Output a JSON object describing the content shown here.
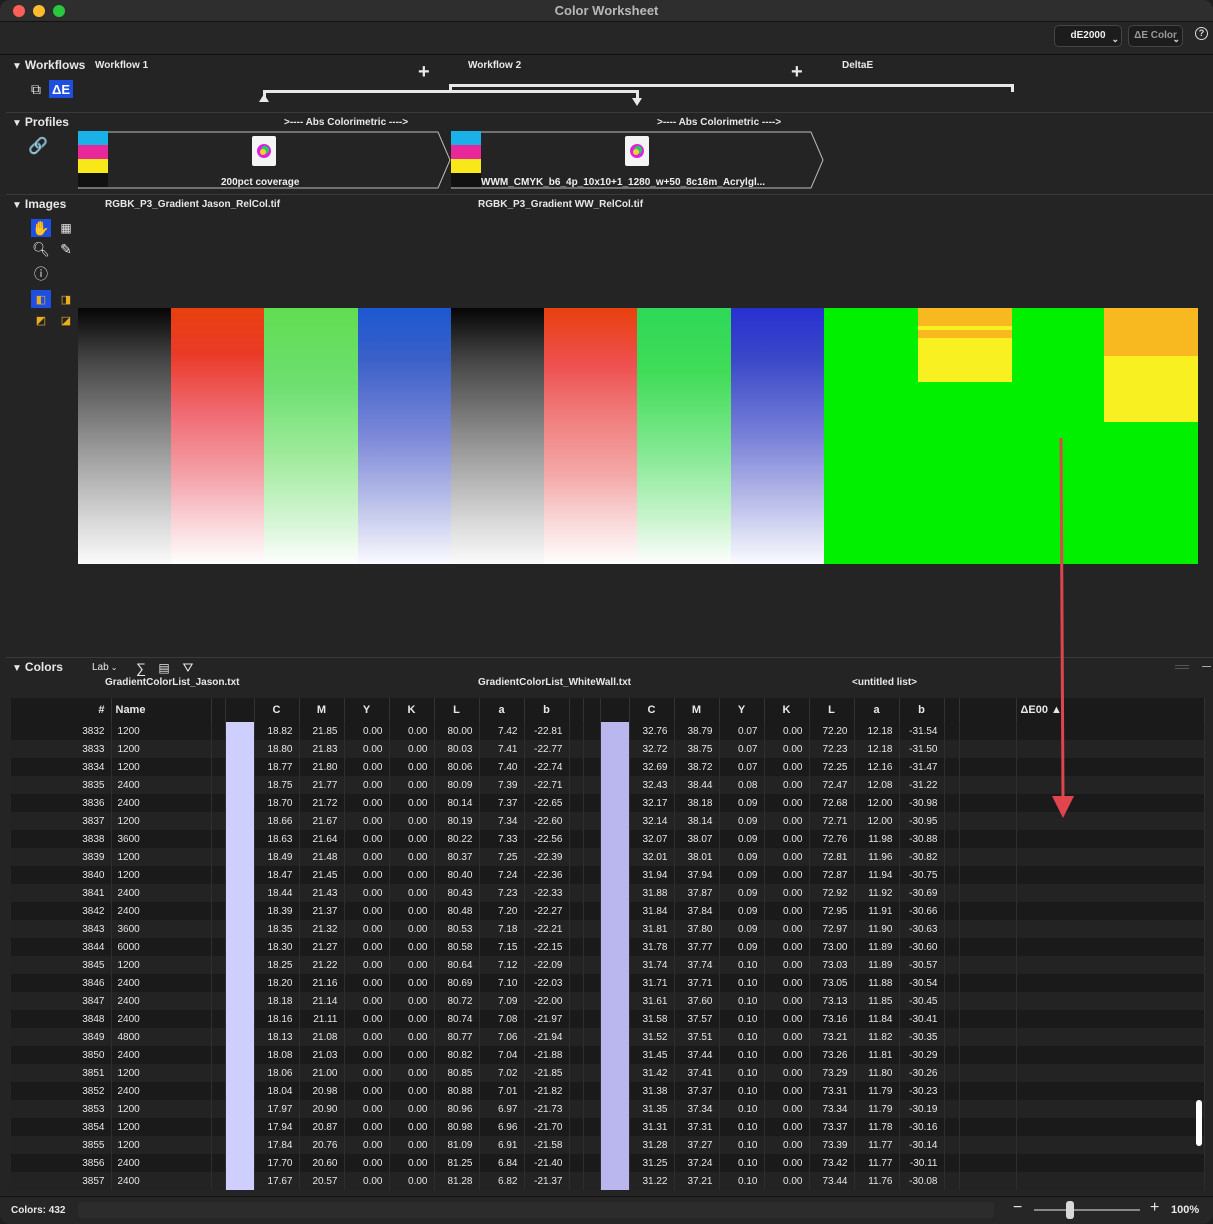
{
  "window": {
    "title": "Color Worksheet"
  },
  "toolbar": {
    "de_button": "dE2000",
    "de_color_button": "ΔE Color",
    "help": "?"
  },
  "workflows": {
    "header": "Workflows",
    "items": [
      "Workflow 1",
      "Workflow 2",
      "DeltaE"
    ],
    "add_symbol": "+"
  },
  "profiles": {
    "header": "Profiles",
    "intents": [
      ">---- Abs Colorimetric ---->",
      ">---- Abs Colorimetric ---->"
    ],
    "items": [
      "200pct coverage",
      "WWM_CMYK_b6_4p_10x10+1_1280_w+50_8c16m_Acrylgl..."
    ]
  },
  "images": {
    "header": "Images",
    "items": [
      "RGBK_P3_Gradient Jason_RelCol.tif",
      "RGBK_P3_Gradient WW_RelCol.tif"
    ]
  },
  "colors": {
    "header": "Colors",
    "mode": "Lab",
    "lists": [
      "GradientColorList_Jason.txt",
      "GradientColorList_WhiteWall.txt",
      "<untitled list>"
    ],
    "columns": [
      "#",
      "Name",
      "",
      "C",
      "M",
      "Y",
      "K",
      "L",
      "a",
      "b",
      "",
      "C",
      "M",
      "Y",
      "K",
      "L",
      "a",
      "b",
      "",
      "ΔE00 ▲"
    ],
    "rows": [
      [
        "3832",
        "1200",
        "18.82",
        "21.85",
        "0.00",
        "0.00",
        "80.00",
        "7.42",
        "-22.81",
        "32.76",
        "38.79",
        "0.07",
        "0.00",
        "72.20",
        "12.18",
        "-31.54"
      ],
      [
        "3833",
        "1200",
        "18.80",
        "21.83",
        "0.00",
        "0.00",
        "80.03",
        "7.41",
        "-22.77",
        "32.72",
        "38.75",
        "0.07",
        "0.00",
        "72.23",
        "12.18",
        "-31.50"
      ],
      [
        "3834",
        "1200",
        "18.77",
        "21.80",
        "0.00",
        "0.00",
        "80.06",
        "7.40",
        "-22.74",
        "32.69",
        "38.72",
        "0.07",
        "0.00",
        "72.25",
        "12.16",
        "-31.47"
      ],
      [
        "3835",
        "2400",
        "18.75",
        "21.77",
        "0.00",
        "0.00",
        "80.09",
        "7.39",
        "-22.71",
        "32.43",
        "38.44",
        "0.08",
        "0.00",
        "72.47",
        "12.08",
        "-31.22"
      ],
      [
        "3836",
        "2400",
        "18.70",
        "21.72",
        "0.00",
        "0.00",
        "80.14",
        "7.37",
        "-22.65",
        "32.17",
        "38.18",
        "0.09",
        "0.00",
        "72.68",
        "12.00",
        "-30.98"
      ],
      [
        "3837",
        "1200",
        "18.66",
        "21.67",
        "0.00",
        "0.00",
        "80.19",
        "7.34",
        "-22.60",
        "32.14",
        "38.14",
        "0.09",
        "0.00",
        "72.71",
        "12.00",
        "-30.95"
      ],
      [
        "3838",
        "3600",
        "18.63",
        "21.64",
        "0.00",
        "0.00",
        "80.22",
        "7.33",
        "-22.56",
        "32.07",
        "38.07",
        "0.09",
        "0.00",
        "72.76",
        "11.98",
        "-30.88"
      ],
      [
        "3839",
        "1200",
        "18.49",
        "21.48",
        "0.00",
        "0.00",
        "80.37",
        "7.25",
        "-22.39",
        "32.01",
        "38.01",
        "0.09",
        "0.00",
        "72.81",
        "11.96",
        "-30.82"
      ],
      [
        "3840",
        "1200",
        "18.47",
        "21.45",
        "0.00",
        "0.00",
        "80.40",
        "7.24",
        "-22.36",
        "31.94",
        "37.94",
        "0.09",
        "0.00",
        "72.87",
        "11.94",
        "-30.75"
      ],
      [
        "3841",
        "2400",
        "18.44",
        "21.43",
        "0.00",
        "0.00",
        "80.43",
        "7.23",
        "-22.33",
        "31.88",
        "37.87",
        "0.09",
        "0.00",
        "72.92",
        "11.92",
        "-30.69"
      ],
      [
        "3842",
        "2400",
        "18.39",
        "21.37",
        "0.00",
        "0.00",
        "80.48",
        "7.20",
        "-22.27",
        "31.84",
        "37.84",
        "0.09",
        "0.00",
        "72.95",
        "11.91",
        "-30.66"
      ],
      [
        "3843",
        "3600",
        "18.35",
        "21.32",
        "0.00",
        "0.00",
        "80.53",
        "7.18",
        "-22.21",
        "31.81",
        "37.80",
        "0.09",
        "0.00",
        "72.97",
        "11.90",
        "-30.63"
      ],
      [
        "3844",
        "6000",
        "18.30",
        "21.27",
        "0.00",
        "0.00",
        "80.58",
        "7.15",
        "-22.15",
        "31.78",
        "37.77",
        "0.09",
        "0.00",
        "73.00",
        "11.89",
        "-30.60"
      ],
      [
        "3845",
        "1200",
        "18.25",
        "21.22",
        "0.00",
        "0.00",
        "80.64",
        "7.12",
        "-22.09",
        "31.74",
        "37.74",
        "0.10",
        "0.00",
        "73.03",
        "11.89",
        "-30.57"
      ],
      [
        "3846",
        "2400",
        "18.20",
        "21.16",
        "0.00",
        "0.00",
        "80.69",
        "7.10",
        "-22.03",
        "31.71",
        "37.71",
        "0.10",
        "0.00",
        "73.05",
        "11.88",
        "-30.54"
      ],
      [
        "3847",
        "2400",
        "18.18",
        "21.14",
        "0.00",
        "0.00",
        "80.72",
        "7.09",
        "-22.00",
        "31.61",
        "37.60",
        "0.10",
        "0.00",
        "73.13",
        "11.85",
        "-30.45"
      ],
      [
        "3848",
        "2400",
        "18.16",
        "21.11",
        "0.00",
        "0.00",
        "80.74",
        "7.08",
        "-21.97",
        "31.58",
        "37.57",
        "0.10",
        "0.00",
        "73.16",
        "11.84",
        "-30.41"
      ],
      [
        "3849",
        "4800",
        "18.13",
        "21.08",
        "0.00",
        "0.00",
        "80.77",
        "7.06",
        "-21.94",
        "31.52",
        "37.51",
        "0.10",
        "0.00",
        "73.21",
        "11.82",
        "-30.35"
      ],
      [
        "3850",
        "2400",
        "18.08",
        "21.03",
        "0.00",
        "0.00",
        "80.82",
        "7.04",
        "-21.88",
        "31.45",
        "37.44",
        "0.10",
        "0.00",
        "73.26",
        "11.81",
        "-30.29"
      ],
      [
        "3851",
        "1200",
        "18.06",
        "21.00",
        "0.00",
        "0.00",
        "80.85",
        "7.02",
        "-21.85",
        "31.42",
        "37.41",
        "0.10",
        "0.00",
        "73.29",
        "11.80",
        "-30.26"
      ],
      [
        "3852",
        "2400",
        "18.04",
        "20.98",
        "0.00",
        "0.00",
        "80.88",
        "7.01",
        "-21.82",
        "31.38",
        "37.37",
        "0.10",
        "0.00",
        "73.31",
        "11.79",
        "-30.23"
      ],
      [
        "3853",
        "1200",
        "17.97",
        "20.90",
        "0.00",
        "0.00",
        "80.96",
        "6.97",
        "-21.73",
        "31.35",
        "37.34",
        "0.10",
        "0.00",
        "73.34",
        "11.79",
        "-30.19"
      ],
      [
        "3854",
        "1200",
        "17.94",
        "20.87",
        "0.00",
        "0.00",
        "80.98",
        "6.96",
        "-21.70",
        "31.31",
        "37.31",
        "0.10",
        "0.00",
        "73.37",
        "11.78",
        "-30.16"
      ],
      [
        "3855",
        "1200",
        "17.84",
        "20.76",
        "0.00",
        "0.00",
        "81.09",
        "6.91",
        "-21.58",
        "31.28",
        "37.27",
        "0.10",
        "0.00",
        "73.39",
        "11.77",
        "-30.14"
      ],
      [
        "3856",
        "2400",
        "17.70",
        "20.60",
        "0.00",
        "0.00",
        "81.25",
        "6.84",
        "-21.40",
        "31.25",
        "37.24",
        "0.10",
        "0.00",
        "73.42",
        "11.77",
        "-30.11"
      ],
      [
        "3857",
        "2400",
        "17.67",
        "20.57",
        "0.00",
        "0.00",
        "81.28",
        "6.82",
        "-21.37",
        "31.22",
        "37.21",
        "0.10",
        "0.00",
        "73.44",
        "11.76",
        "-30.08"
      ]
    ]
  },
  "status": {
    "colors_count": "Colors: 432",
    "zoom": "100%",
    "zoom_minus": "−",
    "zoom_plus": "+"
  },
  "colors_palette": {
    "swatch1": "#cfcfff",
    "swatch2": "#b9b7ee",
    "arrow": "#e0444c",
    "accent": "#1f4fe0"
  }
}
